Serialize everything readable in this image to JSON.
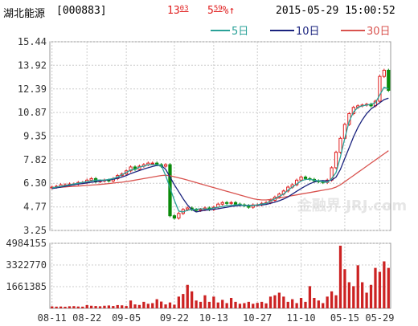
{
  "header": {
    "name": "湖北能源",
    "code": "[000883]",
    "price_main": "13",
    "price_dec": "03",
    "change_main": "5",
    "change_dec": "59",
    "change_suffix": "%↑",
    "datetime": "2015-05-29  15:00:52"
  },
  "legend": [
    {
      "label": "5日",
      "color": "#2aa198"
    },
    {
      "label": "10日",
      "color": "#1a237e"
    },
    {
      "label": "30日",
      "color": "#d9534f"
    }
  ],
  "watermark": "金融界 JRJ.com",
  "colors": {
    "up": "#e02020",
    "down": "#0a8a0a",
    "grid": "#cccccc",
    "axis": "#666666",
    "vol": "#cc2222"
  },
  "chart_data": {
    "type": "candlestick",
    "price_ylim": [
      3.25,
      15.44
    ],
    "price_ticks": [
      "15.44",
      "13.92",
      "12.39",
      "10.87",
      "9.35",
      "7.82",
      "6.30",
      "4.77",
      "3.25"
    ],
    "volume_ylim": [
      0,
      4984155
    ],
    "volume_ticks": [
      "4984155",
      "3322770",
      "1661385"
    ],
    "x_ticks": [
      "08-11",
      "08-22",
      "09-05",
      "09-22",
      "10-13",
      "10-27",
      "11-10",
      "05-15",
      "05-29"
    ],
    "x_tick_index": [
      0,
      8,
      17,
      28,
      37,
      47,
      57,
      67,
      75
    ],
    "close": [
      6.05,
      6.1,
      6.2,
      6.2,
      6.25,
      6.25,
      6.35,
      6.35,
      6.5,
      6.6,
      6.4,
      6.45,
      6.5,
      6.45,
      6.6,
      6.8,
      6.9,
      7.1,
      7.35,
      7.2,
      7.4,
      7.5,
      7.6,
      7.6,
      7.5,
      7.4,
      7.5,
      4.2,
      4.05,
      4.35,
      4.6,
      4.7,
      4.6,
      4.55,
      4.6,
      4.7,
      4.6,
      4.75,
      4.95,
      5.05,
      5.0,
      5.05,
      4.95,
      4.9,
      4.85,
      4.75,
      4.9,
      4.9,
      5.0,
      5.05,
      5.2,
      5.4,
      5.6,
      5.8,
      6.05,
      6.2,
      6.5,
      6.7,
      6.6,
      6.55,
      6.45,
      6.4,
      6.35,
      6.5,
      7.3,
      8.3,
      9.2,
      10.1,
      10.8,
      11.2,
      11.3,
      11.35,
      11.4,
      11.3,
      11.6,
      13.2,
      13.6,
      12.3
    ],
    "ma5": [
      6.0,
      6.05,
      6.1,
      6.15,
      6.2,
      6.25,
      6.3,
      6.35,
      6.4,
      6.45,
      6.5,
      6.5,
      6.5,
      6.55,
      6.6,
      6.7,
      6.85,
      7.0,
      7.15,
      7.2,
      7.35,
      7.4,
      7.5,
      7.5,
      7.5,
      7.45,
      6.8,
      6.0,
      5.2,
      4.5,
      4.45,
      4.55,
      4.6,
      4.62,
      4.65,
      4.63,
      4.63,
      4.7,
      4.75,
      4.8,
      4.85,
      4.88,
      4.9,
      4.92,
      4.85,
      4.85,
      4.87,
      4.9,
      4.95,
      5.0,
      5.15,
      5.3,
      5.45,
      5.6,
      5.85,
      6.05,
      6.25,
      6.45,
      6.55,
      6.55,
      6.5,
      6.45,
      6.4,
      6.35,
      6.6,
      7.0,
      8.0,
      9.2,
      10.3,
      10.9,
      11.2,
      11.3,
      11.35,
      11.4,
      11.5,
      12.0,
      12.5,
      12.4
    ],
    "ma10": [
      5.95,
      6.0,
      6.05,
      6.1,
      6.15,
      6.2,
      6.25,
      6.28,
      6.32,
      6.36,
      6.4,
      6.44,
      6.48,
      6.52,
      6.56,
      6.62,
      6.7,
      6.8,
      6.92,
      7.02,
      7.12,
      7.22,
      7.3,
      7.38,
      7.45,
      7.45,
      7.2,
      6.7,
      6.2,
      5.75,
      5.3,
      4.9,
      4.6,
      4.45,
      4.5,
      4.55,
      4.58,
      4.62,
      4.65,
      4.7,
      4.75,
      4.8,
      4.83,
      4.86,
      4.87,
      4.87,
      4.87,
      4.88,
      4.9,
      4.93,
      5.0,
      5.08,
      5.17,
      5.28,
      5.42,
      5.6,
      5.78,
      5.96,
      6.12,
      6.27,
      6.38,
      6.45,
      6.47,
      6.45,
      6.5,
      6.7,
      7.2,
      7.9,
      8.6,
      9.3,
      9.9,
      10.4,
      10.8,
      11.1,
      11.3,
      11.5,
      11.7,
      11.8
    ],
    "ma30": [
      6.0,
      6.02,
      6.04,
      6.06,
      6.08,
      6.1,
      6.12,
      6.14,
      6.16,
      6.18,
      6.2,
      6.22,
      6.25,
      6.28,
      6.31,
      6.34,
      6.37,
      6.41,
      6.45,
      6.5,
      6.55,
      6.6,
      6.65,
      6.7,
      6.75,
      6.8,
      6.82,
      6.78,
      6.72,
      6.65,
      6.58,
      6.5,
      6.42,
      6.34,
      6.26,
      6.18,
      6.1,
      6.02,
      5.94,
      5.86,
      5.78,
      5.7,
      5.62,
      5.54,
      5.46,
      5.38,
      5.3,
      5.25,
      5.22,
      5.22,
      5.25,
      5.3,
      5.35,
      5.4,
      5.45,
      5.5,
      5.55,
      5.6,
      5.65,
      5.7,
      5.75,
      5.8,
      5.85,
      5.9,
      5.95,
      6.05,
      6.2,
      6.4,
      6.6,
      6.8,
      7.0,
      7.2,
      7.4,
      7.6,
      7.8,
      8.0,
      8.2,
      8.4
    ],
    "volume": [
      150000,
      130000,
      140000,
      120000,
      160000,
      170000,
      140000,
      130000,
      250000,
      200000,
      180000,
      160000,
      200000,
      220000,
      180000,
      250000,
      230000,
      180000,
      600000,
      300000,
      260000,
      500000,
      350000,
      400000,
      700000,
      520000,
      300000,
      450000,
      280000,
      900000,
      1100000,
      1800000,
      1300000,
      600000,
      500000,
      1000000,
      500000,
      900000,
      450000,
      650000,
      400000,
      800000,
      500000,
      350000,
      400000,
      500000,
      350000,
      420000,
      500000,
      380000,
      900000,
      1000000,
      1200000,
      900000,
      500000,
      700000,
      400000,
      800000,
      500000,
      1700000,
      800000,
      600000,
      400000,
      900000,
      1300000,
      1000000,
      4800000,
      3000000,
      2000000,
      1700000,
      3300000,
      2000000,
      1200000,
      1800000,
      3100000,
      2800000,
      3600000,
      3100000
    ]
  }
}
